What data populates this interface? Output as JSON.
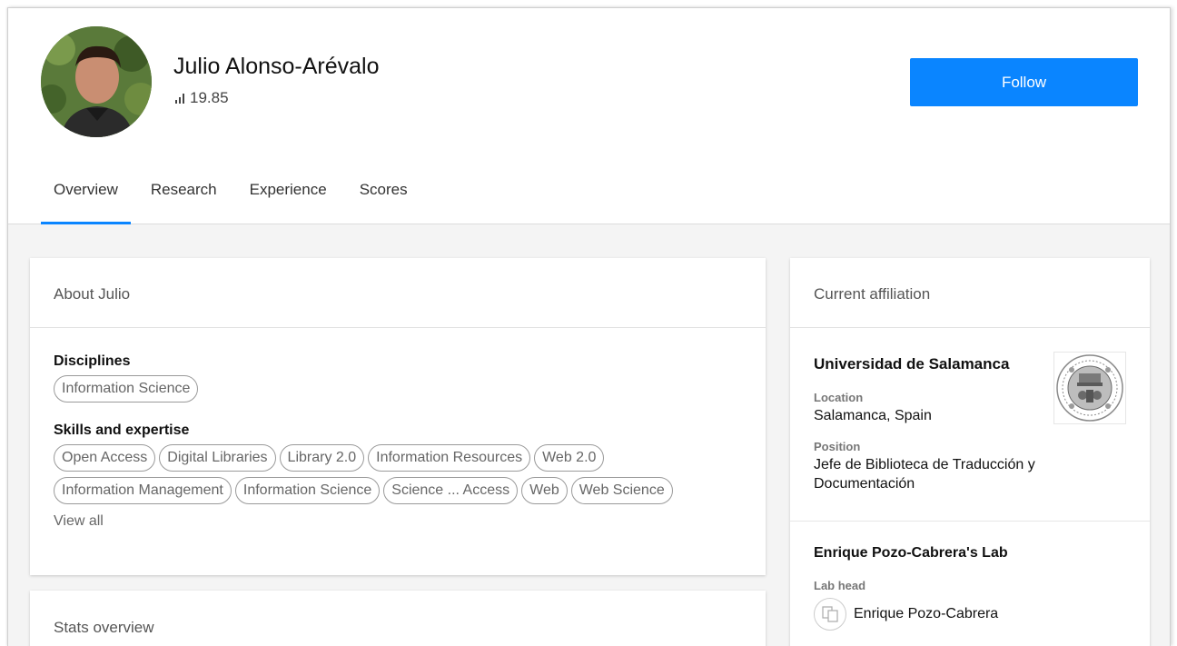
{
  "profile": {
    "name": "Julio Alonso-Arévalo",
    "score": "19.85",
    "follow_label": "Follow"
  },
  "tabs": [
    {
      "label": "Overview",
      "active": true
    },
    {
      "label": "Research",
      "active": false
    },
    {
      "label": "Experience",
      "active": false
    },
    {
      "label": "Scores",
      "active": false
    }
  ],
  "about": {
    "title": "About Julio",
    "disciplines_title": "Disciplines",
    "disciplines": [
      "Information Science"
    ],
    "skills_title": "Skills and expertise",
    "skills": [
      "Open Access",
      "Digital Libraries",
      "Library 2.0",
      "Information Resources",
      "Web 2.0",
      "Information Management",
      "Information Science",
      "Science ... Access",
      "Web",
      "Web Science"
    ],
    "view_all": "View all"
  },
  "stats": {
    "title": "Stats overview"
  },
  "affiliation": {
    "title": "Current affiliation",
    "institution": "Universidad de Salamanca",
    "location_label": "Location",
    "location": "Salamanca, Spain",
    "position_label": "Position",
    "position": "Jefe de Biblioteca de Traducción y Documentación",
    "lab_title": "Enrique Pozo-Cabrera's Lab",
    "lab_head_label": "Lab head",
    "lab_head_name": "Enrique Pozo-Cabrera"
  },
  "colors": {
    "accent": "#0a85ff",
    "background": "#f4f4f4"
  },
  "icons": {
    "score": "bar-chart-icon",
    "institution_logo": "university-seal-icon",
    "lab_head_avatar": "placeholder-avatar-icon"
  }
}
